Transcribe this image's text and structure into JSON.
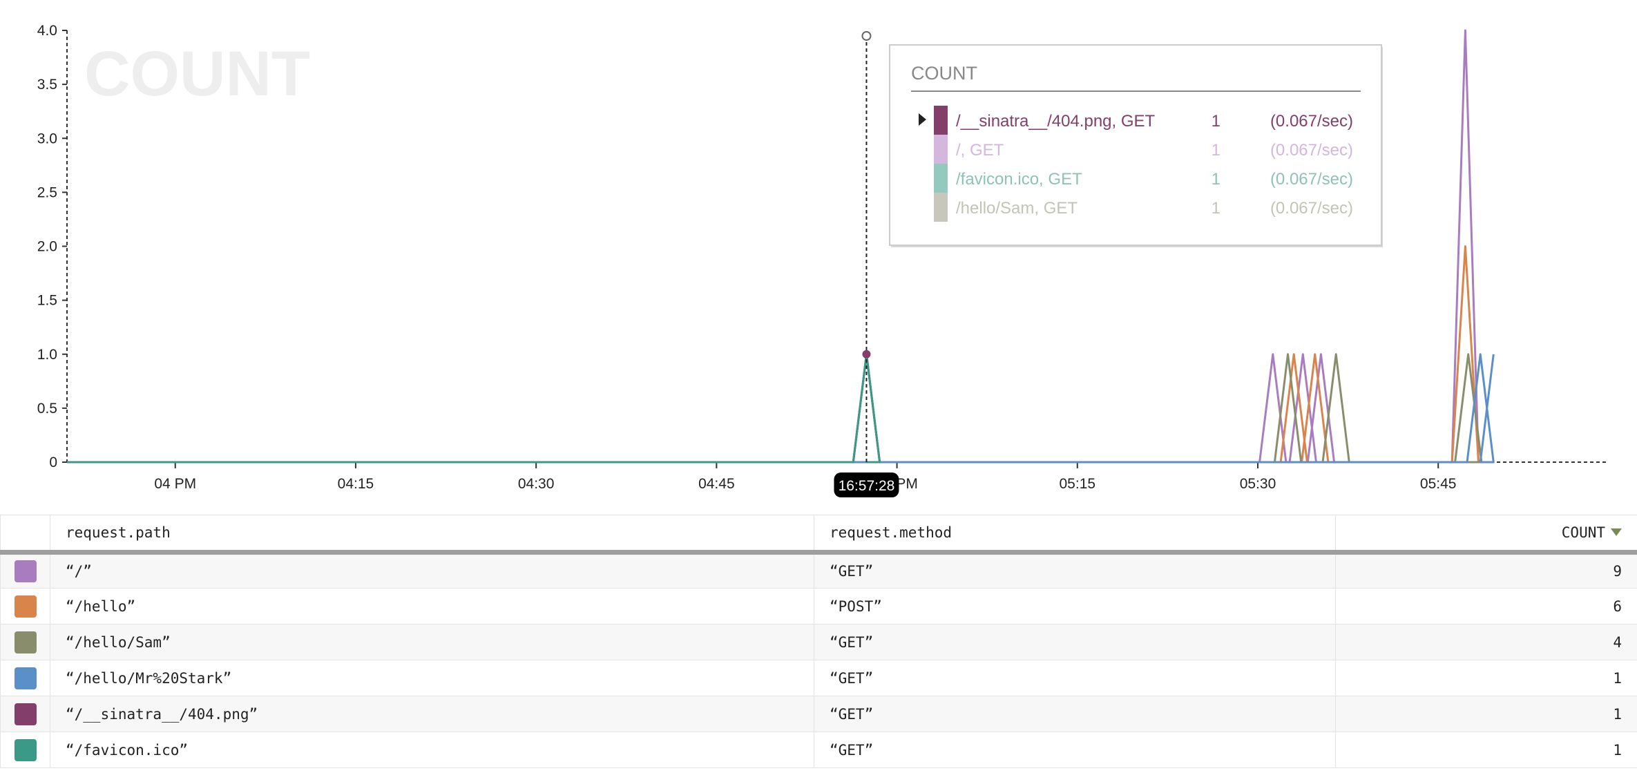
{
  "chart_data": {
    "type": "line",
    "watermark": "COUNT",
    "x_range": [
      "15:51:00",
      "17:59:00"
    ],
    "ylim": [
      0,
      4
    ],
    "y_ticks": [
      {
        "value": 0,
        "label": "0"
      },
      {
        "value": 0.5,
        "label": "0.5"
      },
      {
        "value": 1,
        "label": "1.0"
      },
      {
        "value": 1.5,
        "label": "1.5"
      },
      {
        "value": 2,
        "label": "2.0"
      },
      {
        "value": 2.5,
        "label": "2.5"
      },
      {
        "value": 3,
        "label": "3.0"
      },
      {
        "value": 3.5,
        "label": "3.5"
      },
      {
        "value": 4,
        "label": "4.0"
      }
    ],
    "x_ticks": [
      {
        "time": "16:00",
        "label": "04 PM"
      },
      {
        "time": "16:15",
        "label": "04:15"
      },
      {
        "time": "16:30",
        "label": "04:30"
      },
      {
        "time": "16:45",
        "label": "04:45"
      },
      {
        "time": "17:00",
        "label": "05 PM"
      },
      {
        "time": "17:15",
        "label": "05:15"
      },
      {
        "time": "17:30",
        "label": "05:30"
      },
      {
        "time": "17:45",
        "label": "05:45"
      }
    ],
    "series": [
      {
        "color": "#a97cc0",
        "points": [
          [
            "17:31:15",
            1
          ],
          [
            "17:33:45",
            1
          ],
          [
            "17:35:15",
            1
          ],
          [
            "17:47:15",
            4
          ]
        ]
      },
      {
        "color": "#d9844a",
        "points": [
          [
            "17:33:00",
            1
          ],
          [
            "17:34:45",
            1
          ],
          [
            "17:47:15",
            2
          ]
        ]
      },
      {
        "color": "#8a8d6c",
        "points": [
          [
            "16:57:28",
            1
          ],
          [
            "17:32:30",
            1
          ],
          [
            "17:36:30",
            1
          ],
          [
            "17:47:30",
            1
          ]
        ]
      },
      {
        "color": "#5a8fc7",
        "points": [
          [
            "17:48:30",
            1
          ]
        ]
      },
      {
        "color": "#833f6a",
        "points": [
          [
            "16:57:28",
            1
          ]
        ]
      },
      {
        "color": "#3b9a87",
        "points": [
          [
            "16:57:28",
            1
          ]
        ]
      }
    ],
    "hover": {
      "time": "16:57:28",
      "value": 1
    }
  },
  "tooltip": {
    "title": "COUNT",
    "rows": [
      {
        "label": "/__sinatra__/404.png, GET",
        "count": "1",
        "rate": "(0.067/sec)",
        "color": "#833f6a",
        "text_color": "#833f6a",
        "expanded": true
      },
      {
        "label": "/, GET",
        "count": "1",
        "rate": "(0.067/sec)",
        "color": "#d3b7dd",
        "text_color": "#d3b7dd",
        "expanded": false
      },
      {
        "label": "/favicon.ico, GET",
        "count": "1",
        "rate": "(0.067/sec)",
        "color": "#94c9bd",
        "text_color": "#8ec2b6",
        "expanded": false
      },
      {
        "label": "/hello/Sam, GET",
        "count": "1",
        "rate": "(0.067/sec)",
        "color": "#c7c7bb",
        "text_color": "#c3c3b6",
        "expanded": false
      }
    ]
  },
  "table": {
    "headers": {
      "path": "request.path",
      "method": "request.method",
      "count": "COUNT"
    },
    "sort_icon": "caret-down-icon",
    "rows": [
      {
        "color": "#a97cc0",
        "path": "“/”",
        "method": "“GET”",
        "count": "9"
      },
      {
        "color": "#d9844a",
        "path": "“/hello”",
        "method": "“POST”",
        "count": "6"
      },
      {
        "color": "#8a8d6c",
        "path": "“/hello/Sam”",
        "method": "“GET”",
        "count": "4"
      },
      {
        "color": "#5a8fc7",
        "path": "“/hello/Mr%20Stark”",
        "method": "“GET”",
        "count": "1"
      },
      {
        "color": "#833f6a",
        "path": "“/__sinatra__/404.png”",
        "method": "“GET”",
        "count": "1"
      },
      {
        "color": "#3b9a87",
        "path": "“/favicon.ico”",
        "method": "“GET”",
        "count": "1"
      }
    ]
  }
}
